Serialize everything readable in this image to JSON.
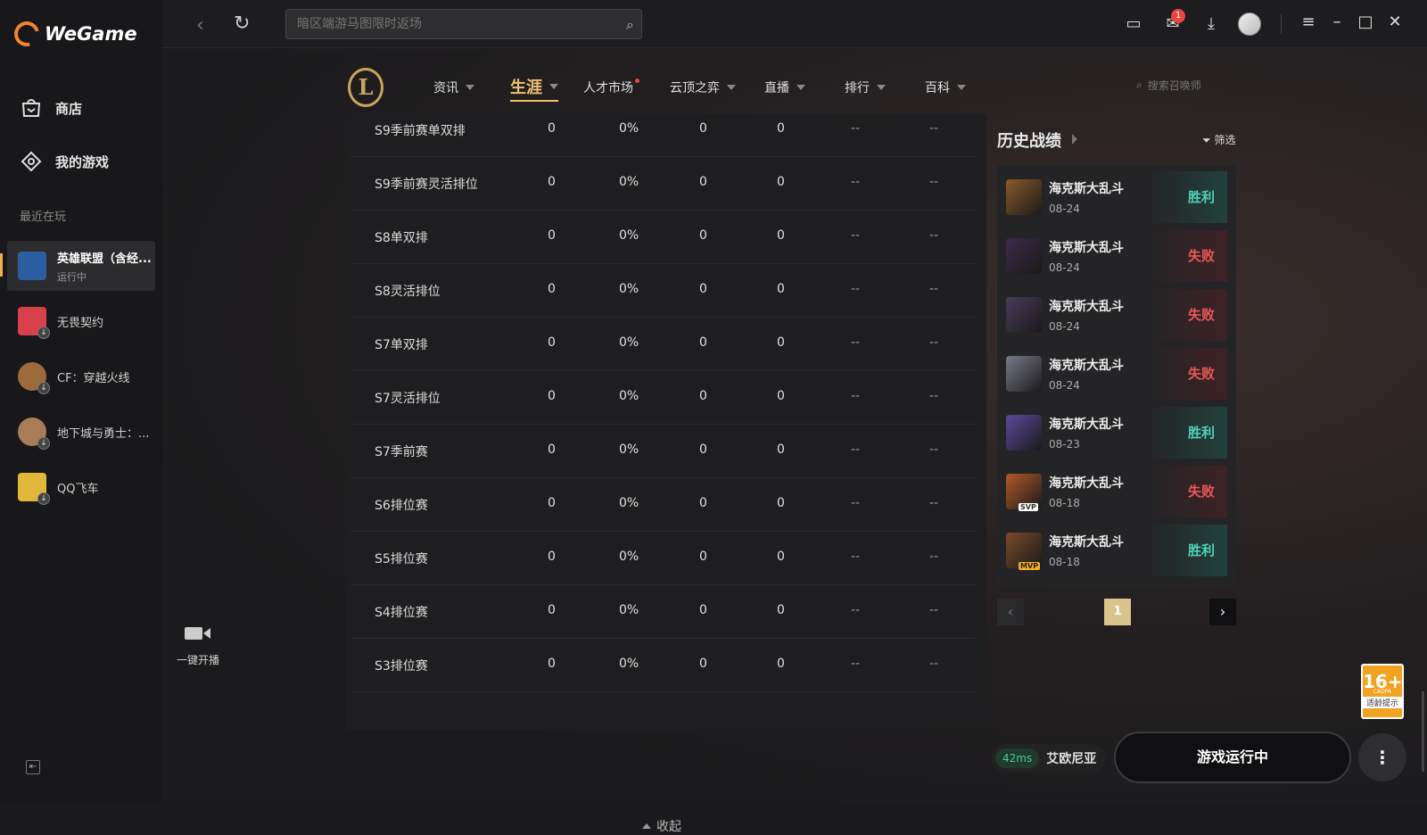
{
  "app": {
    "brand": "WeGame"
  },
  "sidebar": {
    "nav": [
      {
        "label": "商店",
        "icon": "store-icon"
      },
      {
        "label": "我的游戏",
        "icon": "games-icon"
      }
    ],
    "recent_label": "最近在玩",
    "games": [
      {
        "name": "英雄联盟（含经...",
        "status": "运行中",
        "active": true,
        "color": "#2b5ea0"
      },
      {
        "name": "无畏契约",
        "status": "",
        "active": false,
        "color": "#d8414b"
      },
      {
        "name": "CF：穿越火线",
        "status": "",
        "active": false,
        "color": "#9b6b3c"
      },
      {
        "name": "地下城与勇士：...",
        "status": "",
        "active": false,
        "color": "#a77c57"
      },
      {
        "name": "QQ飞车",
        "status": "",
        "active": false,
        "color": "#e0b73a"
      }
    ],
    "stream_label": "一键开播"
  },
  "topbar": {
    "search_placeholder": "暗区端游马图限时返场",
    "mail_badge": "1"
  },
  "tabs": [
    {
      "label": "资讯",
      "caret": true,
      "dot": false
    },
    {
      "label": "生涯",
      "caret": true,
      "dot": false,
      "active": true
    },
    {
      "label": "人才市场",
      "caret": false,
      "dot": true
    },
    {
      "label": "云顶之弈",
      "caret": true,
      "dot": false
    },
    {
      "label": "直播",
      "caret": true,
      "dot": false
    },
    {
      "label": "排行",
      "caret": true,
      "dot": false
    },
    {
      "label": "百科",
      "caret": true,
      "dot": false
    }
  ],
  "summoner_search_placeholder": "搜索召唤师",
  "table": {
    "rows": [
      [
        "S9季前赛单双排",
        "0",
        "0%",
        "0",
        "0",
        "--",
        "--"
      ],
      [
        "S9季前赛灵活排位",
        "0",
        "0%",
        "0",
        "0",
        "--",
        "--"
      ],
      [
        "S8单双排",
        "0",
        "0%",
        "0",
        "0",
        "--",
        "--"
      ],
      [
        "S8灵活排位",
        "0",
        "0%",
        "0",
        "0",
        "--",
        "--"
      ],
      [
        "S7单双排",
        "0",
        "0%",
        "0",
        "0",
        "--",
        "--"
      ],
      [
        "S7灵活排位",
        "0",
        "0%",
        "0",
        "0",
        "--",
        "--"
      ],
      [
        "S7季前赛",
        "0",
        "0%",
        "0",
        "0",
        "--",
        "--"
      ],
      [
        "S6排位赛",
        "0",
        "0%",
        "0",
        "0",
        "--",
        "--"
      ],
      [
        "S5排位赛",
        "0",
        "0%",
        "0",
        "0",
        "--",
        "--"
      ],
      [
        "S4排位赛",
        "0",
        "0%",
        "0",
        "0",
        "--",
        "--"
      ],
      [
        "S3排位赛",
        "0",
        "0%",
        "0",
        "0",
        "--",
        "--"
      ]
    ],
    "collapse_label": "收起"
  },
  "history": {
    "title": "历史战绩",
    "filter_label": "筛选",
    "matches": [
      {
        "mode": "海克斯大乱斗",
        "date": "08-24",
        "result": "胜利",
        "win": true,
        "badge": "",
        "color": "#8a5a2a"
      },
      {
        "mode": "海克斯大乱斗",
        "date": "08-24",
        "result": "失败",
        "win": false,
        "badge": "",
        "color": "#3e2a4a"
      },
      {
        "mode": "海克斯大乱斗",
        "date": "08-24",
        "result": "失败",
        "win": false,
        "badge": "",
        "color": "#4a3a5a"
      },
      {
        "mode": "海克斯大乱斗",
        "date": "08-24",
        "result": "失败",
        "win": false,
        "badge": "",
        "color": "#7a7a88"
      },
      {
        "mode": "海克斯大乱斗",
        "date": "08-23",
        "result": "胜利",
        "win": true,
        "badge": "",
        "color": "#5a4a9a"
      },
      {
        "mode": "海克斯大乱斗",
        "date": "08-18",
        "result": "失败",
        "win": false,
        "badge": "SVP",
        "color": "#b05a2a"
      },
      {
        "mode": "海克斯大乱斗",
        "date": "08-18",
        "result": "胜利",
        "win": true,
        "badge": "MVP",
        "color": "#7a4a2a"
      }
    ],
    "page": "1"
  },
  "footer": {
    "ping": "42ms",
    "server": "艾欧尼亚",
    "launch_label": "游戏运行中",
    "age_rating": "16+",
    "age_sub": "CADPA",
    "age_note": "适龄提示"
  }
}
